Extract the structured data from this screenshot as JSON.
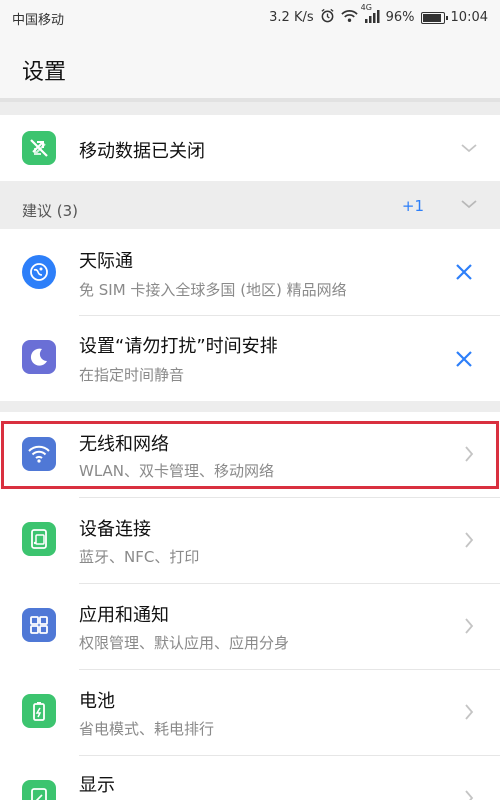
{
  "status_bar": {
    "carrier": "中国移动",
    "speed": "3.2 K/s",
    "network": "4G",
    "battery_text": "96%",
    "battery_level": 0.96,
    "time": "10:04"
  },
  "header": {
    "title": "设置"
  },
  "mobile_data": {
    "label": "移动数据已关闭"
  },
  "suggestions": {
    "label": "建议 (3)",
    "badge": "+1",
    "items": [
      {
        "title": "天际通",
        "subtitle": "免 SIM 卡接入全球多国 (地区) 精品网络"
      },
      {
        "title": "设置“请勿打扰”时间安排",
        "subtitle": "在指定时间静音"
      }
    ]
  },
  "settings": {
    "items": [
      {
        "title": "无线和网络",
        "subtitle": "WLAN、双卡管理、移动网络",
        "icon": "wifi-icon"
      },
      {
        "title": "设备连接",
        "subtitle": "蓝牙、NFC、打印",
        "icon": "device-connection-icon"
      },
      {
        "title": "应用和通知",
        "subtitle": "权限管理、默认应用、应用分身",
        "icon": "apps-grid-icon"
      },
      {
        "title": "电池",
        "subtitle": "省电模式、耗电排行",
        "icon": "battery-icon"
      },
      {
        "title": "显示",
        "subtitle": "",
        "icon": "display-icon"
      }
    ]
  },
  "colors": {
    "accent_blue": "#2d7ff9",
    "green_icon": "#3cc46f",
    "purple_icon": "#6a6fd6",
    "blue_icon": "#4f78d6",
    "highlight_red": "#d9303f"
  }
}
